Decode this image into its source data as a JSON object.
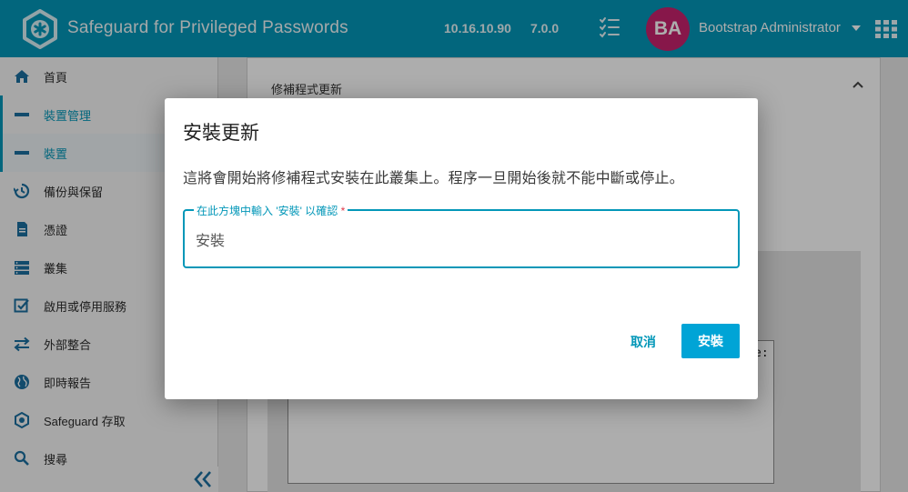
{
  "header": {
    "app_title": "Safeguard for Privileged Passwords",
    "ip_address": "10.16.10.90",
    "version": "7.0.0",
    "avatar_initials": "BA",
    "user_name": "Bootstrap Administrator",
    "accent_color": "#0397b8",
    "avatar_color": "#c7226d",
    "icons": [
      "safeguard-logo-icon",
      "tasks-checklist-icon",
      "caret-down-icon",
      "app-grid-icon"
    ]
  },
  "sidebar": {
    "items": [
      {
        "label": "首頁",
        "icon": "home-icon"
      },
      {
        "label": "裝置管理",
        "icon": "device-icon"
      },
      {
        "label": "裝置",
        "icon": "device-icon"
      },
      {
        "label": "備份與保留",
        "icon": "backup-icon"
      },
      {
        "label": "憑證",
        "icon": "certificate-icon"
      },
      {
        "label": "叢集",
        "icon": "cluster-icon"
      },
      {
        "label": "啟用或停用服務",
        "icon": "checkbox-icon"
      },
      {
        "label": "外部整合",
        "icon": "exchange-arrows-icon"
      },
      {
        "label": "即時報告",
        "icon": "globe-icon"
      },
      {
        "label": "Safeguard 存取",
        "icon": "safeguard-icon"
      },
      {
        "label": "搜尋",
        "icon": "search-icon"
      }
    ],
    "collapse_icon": "double-chevron-left-icon"
  },
  "main": {
    "panel_title": "修補程式更新",
    "textarea_text": "e:"
  },
  "dialog": {
    "title": "安裝更新",
    "message": "這將會開始將修補程式安裝在此叢集上。程序一旦開始後就不能中斷或停止。",
    "field_label": "在此方塊中輸入 '安裝' 以確認",
    "field_required_mark": "*",
    "field_value": "安裝",
    "cancel_label": "取消",
    "install_label": "安裝"
  }
}
